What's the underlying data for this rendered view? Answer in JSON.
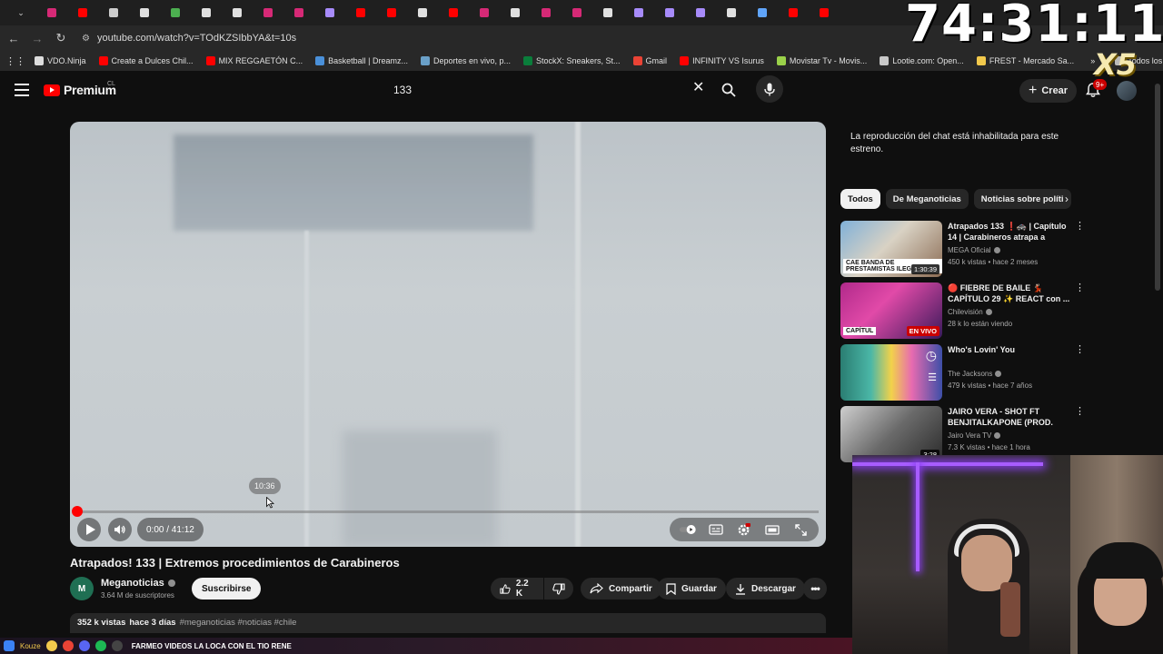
{
  "browser": {
    "tabs": [
      {
        "icon": "instagram-icon",
        "color": "#d62976"
      },
      {
        "icon": "youtube-icon",
        "color": "#ff0000"
      },
      {
        "icon": "close-icon",
        "color": "#cccccc"
      },
      {
        "icon": "tiktok-icon",
        "color": "#e0e0e0"
      },
      {
        "icon": "spinner-icon",
        "color": "#4caf50"
      },
      {
        "icon": "tiktok-icon",
        "color": "#e0e0e0"
      },
      {
        "icon": "tiktok-icon",
        "color": "#e0e0e0"
      },
      {
        "icon": "instagram-icon",
        "color": "#d62976"
      },
      {
        "icon": "instagram-icon",
        "color": "#d62976"
      },
      {
        "icon": "pen-icon",
        "color": "#a78bfa"
      },
      {
        "icon": "youtube-icon",
        "color": "#ff0000"
      },
      {
        "icon": "youtube-icon",
        "color": "#ff0000"
      },
      {
        "icon": "tiktok-icon",
        "color": "#e0e0e0"
      },
      {
        "icon": "youtube-icon",
        "color": "#ff0000"
      },
      {
        "icon": "instagram-icon",
        "color": "#d62976"
      },
      {
        "icon": "tiktok-icon",
        "color": "#e0e0e0"
      },
      {
        "icon": "instagram-icon",
        "color": "#d62976"
      },
      {
        "icon": "instagram-icon",
        "color": "#d62976"
      },
      {
        "icon": "x-icon",
        "color": "#e0e0e0"
      },
      {
        "icon": "pen-icon",
        "color": "#a78bfa"
      },
      {
        "icon": "pen-icon",
        "color": "#a78bfa"
      },
      {
        "icon": "pen-icon",
        "color": "#a78bfa"
      },
      {
        "icon": "tiktok-icon",
        "color": "#e0e0e0"
      },
      {
        "icon": "bird-icon",
        "color": "#60a5fa"
      },
      {
        "icon": "youtube-icon",
        "color": "#ff0000"
      },
      {
        "icon": "youtube-icon",
        "color": "#ff0000"
      }
    ],
    "url": "youtube.com/watch?v=TOdKZSIbbYA&t=10s",
    "bookmarks": [
      {
        "label": "VDO.Ninja",
        "color": "#dddddd"
      },
      {
        "label": "Create a Dulces Chil...",
        "color": "#ff0000"
      },
      {
        "label": "MIX REGGAETÓN C...",
        "color": "#ff0000"
      },
      {
        "label": "Basketball | Dreamz...",
        "color": "#4a90d9"
      },
      {
        "label": "Deportes en vivo, p...",
        "color": "#6aa0c8"
      },
      {
        "label": "StockX: Sneakers, St...",
        "color": "#0a7d3b"
      },
      {
        "label": "Gmail",
        "color": "#ea4335"
      },
      {
        "label": "INFINITY VS Isurus",
        "color": "#ff0000"
      },
      {
        "label": "Movistar Tv - Movis...",
        "color": "#9bd24a"
      },
      {
        "label": "Lootie.com: Open...",
        "color": "#c8c8c8"
      },
      {
        "label": "FREST - Mercado Sa...",
        "color": "#f2c94c"
      }
    ],
    "bookmarks_more": "»",
    "bookmarks_folder": "Todos los marcadores"
  },
  "overlay": {
    "timer": "74:31:11",
    "multiplier": "X5"
  },
  "youtube": {
    "logo_text": "Premium",
    "country": "CL",
    "search_value": "133",
    "create_label": "Crear",
    "notifications": "9+"
  },
  "player": {
    "hover_time": "10:36",
    "time": "0:00 / 41:12",
    "progress_fraction": 0.0
  },
  "video": {
    "title": "Atrapados! 133 | Extremos procedimientos de Carabineros",
    "channel": "Meganoticias",
    "channel_initials": "M",
    "subscribers": "3.64 M de suscriptores",
    "subscribe_label": "Suscribirse",
    "likes": "2.2 K",
    "share_label": "Compartir",
    "save_label": "Guardar",
    "download_label": "Descargar",
    "views": "352 k vistas",
    "date": "hace 3 días",
    "tags": "#meganoticias #noticias #chile"
  },
  "sidebar": {
    "chat_note": "La reproducción del chat está inhabilitada para este estreno.",
    "chips": [
      "Todos",
      "De Meganoticias",
      "Noticias sobre políti"
    ],
    "recommendations": [
      {
        "title": "Atrapados 133 ❗🚓 | Capítulo 14 | Carabineros atrapa a banda ...",
        "channel": "MEGA Oficial",
        "meta": "450 k vistas • hace 2 meses",
        "badge": "1:30:39",
        "thumb_label": "CAE BANDA DE PRESTAMISTAS ILEG",
        "live": false
      },
      {
        "title": "🔴 FIEBRE DE BAILE 💃🏻 CAPÍTULO 29 ✨ REACT con ...",
        "channel": "Chilevisión",
        "meta": "28 k lo están viendo",
        "badge": "EN VIVO",
        "thumb_label": "CAPÍTUL",
        "live": true
      },
      {
        "title": "Who's Lovin' You",
        "channel": "The Jacksons",
        "meta": "479 k vistas • hace 7 años",
        "badge": "",
        "thumb_label": "",
        "live": false
      },
      {
        "title": "JAIRO VERA - SHOT FT BENJITALKAPONE (PROD. AG...",
        "channel": "Jairo Vera TV",
        "meta": "7.3 K vistas • hace 1 hora",
        "badge": "3:28",
        "thumb_label": "",
        "live": false
      }
    ]
  },
  "taskbar": {
    "title": "FARMEO VIDEOS LA LOCA CON EL TIO RENE",
    "user": "Kouze"
  }
}
